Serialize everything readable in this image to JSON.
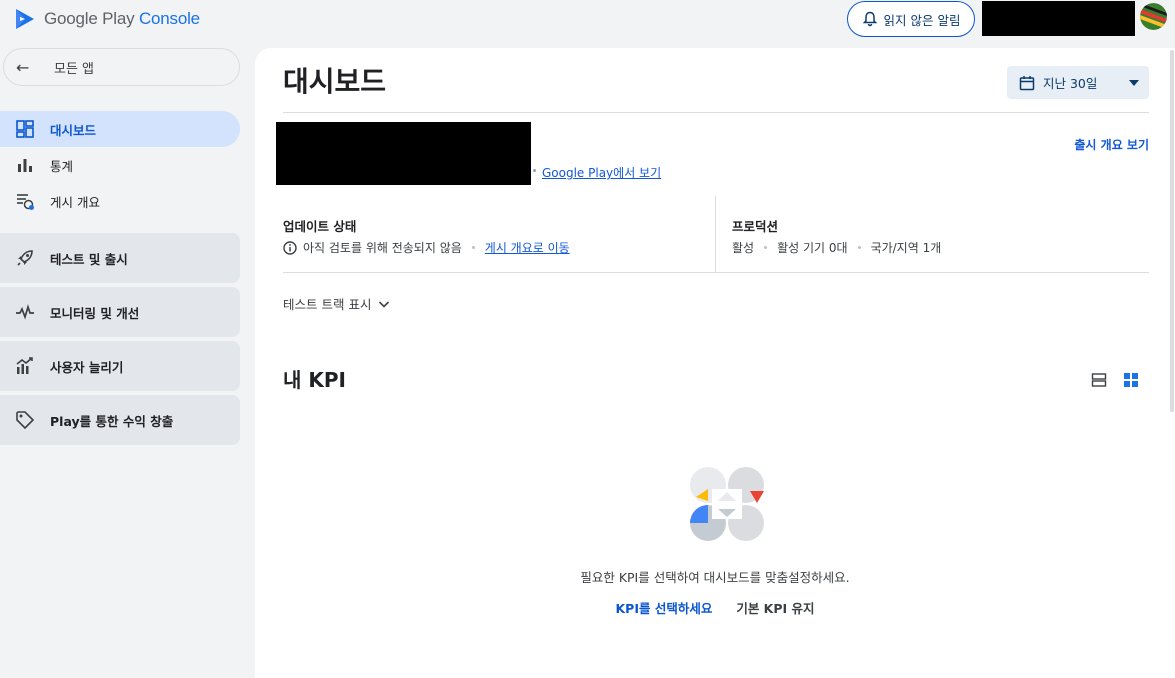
{
  "app": {
    "logo_text_prefix": "Google Play",
    "logo_text_accent": "Console"
  },
  "header": {
    "notifications_label": "읽지 않은 알림"
  },
  "sidebar": {
    "back_label": "모든 앱",
    "items": [
      {
        "label": "대시보드",
        "icon": "dashboard-icon",
        "active": true
      },
      {
        "label": "통계",
        "icon": "bar-chart-icon",
        "active": false
      },
      {
        "label": "게시 개요",
        "icon": "publishing-overview-icon",
        "active": false
      }
    ],
    "groups": [
      {
        "label": "테스트 및 출시",
        "icon": "rocket-icon"
      },
      {
        "label": "모니터링 및 개선",
        "icon": "vitals-icon"
      },
      {
        "label": "사용자 늘리기",
        "icon": "grow-users-icon"
      },
      {
        "label": "Play를 통한 수익 창출",
        "icon": "tag-icon"
      }
    ]
  },
  "main": {
    "title": "대시보드",
    "date_range": "지난 30일",
    "play_link": "Google Play에서 보기",
    "release_overview_link": "출시 개요 보기",
    "update_status": {
      "heading": "업데이트 상태",
      "message": "아직 검토를 위해 전송되지 않음",
      "link": "게시 개요로 이동"
    },
    "production": {
      "heading": "프로덕션",
      "state": "활성",
      "devices": "활성 기기 0대",
      "countries": "국가/지역 1개"
    },
    "test_track_toggle": "테스트 트랙 표시",
    "kpi": {
      "title": "내 KPI",
      "empty_message": "필요한 KPI를 선택하여 대시보드를 맞춤설정하세요.",
      "select_button": "KPI를 선택하세요",
      "keep_default_button": "기본 KPI 유지"
    }
  },
  "colors": {
    "accent": "#0b57d0",
    "active_nav_bg": "#d3e3fd",
    "group_bg": "#e3e6ea",
    "link": "#1558d6"
  }
}
